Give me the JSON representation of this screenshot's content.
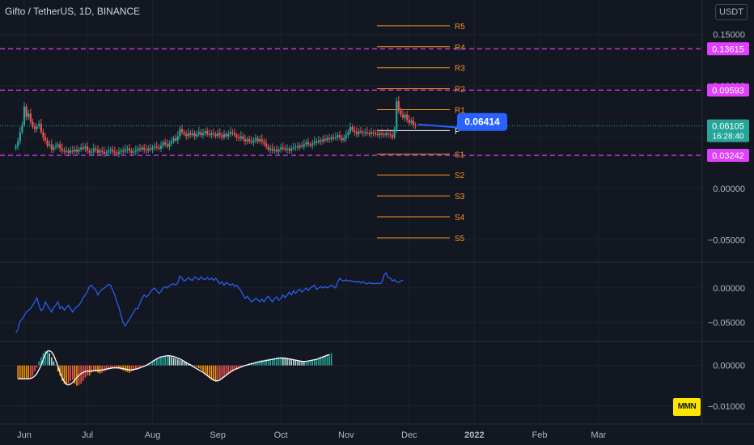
{
  "header": {
    "title": "Gifto / TetherUS, 1D, BINANCE",
    "currency": "USDT"
  },
  "logo": {
    "text": "MMN"
  },
  "colors": {
    "background": "#131722",
    "up": "#26a69a",
    "down": "#ef5350",
    "level_dash": "#e040fb",
    "pivot": "#f7931a",
    "indicator_line": "#2962ff",
    "callout": "#2962ff",
    "current_price": "#26a69a"
  },
  "chart_data": [
    {
      "type": "candlestick",
      "pane": "price",
      "x_ticks": [
        "Jun",
        "Jul",
        "Aug",
        "Sep",
        "Oct",
        "Nov",
        "Dec",
        "2022",
        "Feb",
        "Mar"
      ],
      "y_ticks": [
        "0.15000",
        "0.10000",
        "0.05000",
        "0.00000",
        "−0.05000"
      ],
      "ylim": [
        -0.07,
        0.16
      ],
      "y_tick_values": [
        0.15,
        0.1,
        0.05,
        0.0,
        -0.05
      ],
      "closes": [
        0.041,
        0.046,
        0.055,
        0.062,
        0.08,
        0.07,
        0.073,
        0.065,
        0.06,
        0.058,
        0.061,
        0.063,
        0.055,
        0.05,
        0.047,
        0.042,
        0.043,
        0.038,
        0.04,
        0.041,
        0.043,
        0.039,
        0.037,
        0.036,
        0.037,
        0.035,
        0.037,
        0.036,
        0.038,
        0.036,
        0.038,
        0.04,
        0.039,
        0.041,
        0.037,
        0.035,
        0.036,
        0.039,
        0.038,
        0.035,
        0.037,
        0.036,
        0.034,
        0.035,
        0.037,
        0.038,
        0.036,
        0.035,
        0.034,
        0.036,
        0.037,
        0.036,
        0.038,
        0.039,
        0.037,
        0.035,
        0.036,
        0.037,
        0.039,
        0.038,
        0.04,
        0.038,
        0.037,
        0.039,
        0.038,
        0.04,
        0.041,
        0.04,
        0.039,
        0.042,
        0.045,
        0.043,
        0.041,
        0.044,
        0.046,
        0.049,
        0.047,
        0.051,
        0.058,
        0.055,
        0.053,
        0.051,
        0.054,
        0.052,
        0.054,
        0.051,
        0.053,
        0.055,
        0.052,
        0.054,
        0.056,
        0.053,
        0.052,
        0.054,
        0.053,
        0.051,
        0.054,
        0.052,
        0.05,
        0.053,
        0.051,
        0.053,
        0.055,
        0.054,
        0.052,
        0.05,
        0.049,
        0.051,
        0.048,
        0.046,
        0.048,
        0.046,
        0.045,
        0.047,
        0.049,
        0.046,
        0.048,
        0.046,
        0.044,
        0.041,
        0.038,
        0.039,
        0.037,
        0.038,
        0.036,
        0.038,
        0.04,
        0.039,
        0.038,
        0.039,
        0.037,
        0.039,
        0.04,
        0.041,
        0.04,
        0.042,
        0.041,
        0.043,
        0.045,
        0.043,
        0.042,
        0.044,
        0.046,
        0.045,
        0.047,
        0.046,
        0.048,
        0.047,
        0.049,
        0.048,
        0.05,
        0.049,
        0.05,
        0.052,
        0.05,
        0.047,
        0.049,
        0.052,
        0.055,
        0.06,
        0.057,
        0.055,
        0.053,
        0.056,
        0.055,
        0.054,
        0.055,
        0.054,
        0.053,
        0.055,
        0.054,
        0.053,
        0.052,
        0.054,
        0.053,
        0.052,
        0.054,
        0.053,
        0.052,
        0.05,
        0.058,
        0.085,
        0.076,
        0.072,
        0.069,
        0.072,
        0.067,
        0.064,
        0.066,
        0.062,
        0.061
      ],
      "start_date": "2021-05-28",
      "current_price": 0.06105,
      "countdown": "16:28:40",
      "levels": [
        {
          "value": 0.13615,
          "label": "0.13615",
          "style": "dashed"
        },
        {
          "value": 0.09593,
          "label": "0.09593",
          "style": "dashed"
        },
        {
          "value": 0.03242,
          "label": "0.03242",
          "style": "dashed"
        }
      ],
      "pivots": [
        {
          "label": "R5",
          "value": 0.1585
        },
        {
          "label": "R4",
          "value": 0.1381
        },
        {
          "label": "R3",
          "value": 0.1177
        },
        {
          "label": "R2",
          "value": 0.0973
        },
        {
          "label": "R1",
          "value": 0.0769
        },
        {
          "label": "P",
          "value": 0.0565
        },
        {
          "label": "S1",
          "value": 0.0337
        },
        {
          "label": "S2",
          "value": 0.0133
        },
        {
          "label": "S3",
          "value": -0.0071
        },
        {
          "label": "S4",
          "value": -0.0275
        },
        {
          "label": "S5",
          "value": -0.0479
        }
      ],
      "callout": {
        "label": "0.06414",
        "value": 0.06414
      }
    },
    {
      "type": "line",
      "pane": "indicator-1",
      "y_ticks": [
        "0.00000",
        "−0.05000"
      ],
      "ylim": [
        -0.075,
        0.035
      ],
      "y_tick_values": [
        0.0,
        -0.05
      ],
      "values": [
        -0.065,
        -0.06,
        -0.048,
        -0.045,
        -0.04,
        -0.035,
        -0.032,
        -0.03,
        -0.025,
        -0.02,
        -0.014,
        -0.025,
        -0.033,
        -0.03,
        -0.02,
        -0.025,
        -0.03,
        -0.035,
        -0.028,
        -0.025,
        -0.02,
        -0.03,
        -0.027,
        -0.032,
        -0.028,
        -0.025,
        -0.03,
        -0.035,
        -0.03,
        -0.027,
        -0.025,
        -0.02,
        -0.014,
        -0.01,
        -0.005,
        0.002,
        0.004,
        0.0,
        -0.003,
        -0.01,
        -0.005,
        -0.002,
        0.0,
        0.002,
        0.005,
        0.004,
        -0.003,
        -0.01,
        -0.02,
        -0.028,
        -0.04,
        -0.05,
        -0.055,
        -0.05,
        -0.045,
        -0.04,
        -0.035,
        -0.03,
        -0.03,
        -0.022,
        -0.015,
        -0.01,
        -0.013,
        -0.01,
        -0.006,
        -0.002,
        0.0,
        -0.004,
        -0.008,
        -0.005,
        0.0,
        0.002,
        0.0,
        0.003,
        0.005,
        0.006,
        0.004,
        0.008,
        0.017,
        0.014,
        0.01,
        0.012,
        0.015,
        0.012,
        0.011,
        0.016,
        0.014,
        0.012,
        0.016,
        0.013,
        0.012,
        0.015,
        0.012,
        0.014,
        0.011,
        0.014,
        0.01,
        0.006,
        0.009,
        0.004,
        0.008,
        0.006,
        0.004,
        0.006,
        0.002,
        0.004,
        0.0,
        -0.004,
        -0.01,
        -0.015,
        -0.012,
        -0.016,
        -0.02,
        -0.018,
        -0.015,
        -0.017,
        -0.02,
        -0.016,
        -0.02,
        -0.015,
        -0.012,
        -0.016,
        -0.02,
        -0.015,
        -0.013,
        -0.018,
        -0.015,
        -0.01,
        -0.014,
        -0.01,
        -0.006,
        -0.01,
        -0.004,
        -0.008,
        -0.004,
        -0.002,
        -0.006,
        -0.003,
        0.0,
        -0.004,
        0.0,
        0.002,
        0.004,
        -0.002,
        0.0,
        0.002,
        0.0,
        0.002,
        0.0,
        0.002,
        0.004,
        0.002,
        0.0,
        0.009,
        0.014,
        0.011,
        0.01,
        0.012,
        0.01,
        0.011,
        0.009,
        0.01,
        0.008,
        0.01,
        0.007,
        0.009,
        0.007,
        0.006,
        0.008,
        0.006,
        0.007,
        0.006,
        0.007,
        0.006,
        0.008,
        0.018,
        0.022,
        0.015,
        0.014,
        0.01,
        0.012,
        0.009,
        0.008,
        0.01,
        0.011
      ]
    },
    {
      "type": "histogram",
      "pane": "indicator-2",
      "y_ticks": [
        "0.00000",
        "−0.01000"
      ],
      "ylim": [
        -0.014,
        0.0055
      ],
      "y_tick_values": [
        0.0,
        -0.01
      ],
      "values": [
        -0.0033,
        -0.0033,
        -0.0033,
        -0.0033,
        -0.0033,
        -0.0033,
        -0.003,
        -0.0025,
        -0.0015,
        -0.0005,
        0.001,
        0.002,
        0.003,
        0.0035,
        0.0035,
        0.003,
        0.002,
        0.001,
        0.0,
        -0.0015,
        -0.0025,
        -0.0038,
        -0.0045,
        -0.0048,
        -0.0045,
        -0.0038,
        -0.0035,
        -0.0045,
        -0.005,
        -0.0048,
        -0.0045,
        -0.0038,
        -0.003,
        -0.0025,
        -0.0025,
        -0.0018,
        -0.0015,
        -0.0015,
        -0.0018,
        -0.002,
        -0.0018,
        -0.0015,
        -0.0012,
        -0.001,
        -0.0008,
        -0.0006,
        -0.0005,
        -0.0006,
        -0.0008,
        -0.001,
        -0.0012,
        -0.0015,
        -0.0016,
        -0.0018,
        -0.0015,
        -0.0013,
        -0.001,
        -0.0008,
        -0.0006,
        -0.0004,
        -0.0002,
        0.0,
        0.0003,
        0.0006,
        0.001,
        0.0013,
        0.0016,
        0.0018,
        0.002,
        0.002,
        0.0022,
        0.0024,
        0.0023,
        0.0021,
        0.0019,
        0.0017,
        0.0015,
        0.0013,
        0.0011,
        0.0009,
        0.0007,
        0.0005,
        0.0003,
        0.0001,
        -0.0002,
        -0.0004,
        -0.0007,
        -0.001,
        -0.0015,
        -0.002,
        -0.0025,
        -0.003,
        -0.0035,
        -0.0038,
        -0.004,
        -0.0038,
        -0.0035,
        -0.003,
        -0.0025,
        -0.0022,
        -0.002,
        -0.0017,
        -0.0015,
        -0.0012,
        -0.001,
        -0.0008,
        -0.0005,
        -0.0003,
        0.0,
        0.0002,
        0.0004,
        0.0006,
        0.0007,
        0.0008,
        0.001,
        0.0012,
        0.0013,
        0.0014,
        0.0015,
        0.0016,
        0.0016,
        0.0017,
        0.0018,
        0.0019,
        0.002,
        0.0021,
        0.002,
        0.0019,
        0.0018,
        0.0017,
        0.0016,
        0.0015,
        0.0014,
        0.0013,
        0.0012,
        0.0011,
        0.001,
        0.001,
        0.0011,
        0.0012,
        0.0013,
        0.0014,
        0.0016,
        0.0018,
        0.002,
        0.0022,
        0.0024,
        0.0026,
        0.0028,
        0.003
      ],
      "signal": [
        -0.0033,
        -0.0033,
        -0.0033,
        -0.0033,
        -0.0033,
        -0.0033,
        -0.0032,
        -0.003,
        -0.0026,
        -0.002,
        -0.001,
        0.0,
        0.0015,
        0.0028,
        0.0035,
        0.0036,
        0.0033,
        0.0025,
        0.0012,
        -0.0002,
        -0.0018,
        -0.003,
        -0.004,
        -0.0046,
        -0.0048,
        -0.0046,
        -0.0042,
        -0.0036,
        -0.003,
        -0.0024,
        -0.002,
        -0.0017,
        -0.0015,
        -0.0014,
        -0.0014,
        -0.0014,
        -0.0013,
        -0.0012,
        -0.0012,
        -0.0012,
        -0.0011,
        -0.001,
        -0.0009,
        -0.0008,
        -0.0007,
        -0.0006,
        -0.0006,
        -0.0006,
        -0.0006,
        -0.0007,
        -0.0008,
        -0.0009,
        -0.001,
        -0.0011,
        -0.0011,
        -0.001,
        -0.0009,
        -0.0008,
        -0.0006,
        -0.0004,
        -0.0002,
        0.0,
        0.0003,
        0.0006,
        0.001,
        0.0013,
        0.0016,
        0.0019,
        0.0021,
        0.0022,
        0.0023,
        0.0024,
        0.0024,
        0.0023,
        0.0022,
        0.002,
        0.0018,
        0.0016,
        0.0013,
        0.001,
        0.0007,
        0.0004,
        0.0001,
        -0.0002,
        -0.0005,
        -0.0008,
        -0.0011,
        -0.0014,
        -0.0017,
        -0.0021,
        -0.0025,
        -0.0029,
        -0.0033,
        -0.0036,
        -0.0038,
        -0.0038,
        -0.0036,
        -0.0032,
        -0.0028,
        -0.0024,
        -0.002,
        -0.0016,
        -0.0013,
        -0.001,
        -0.0008,
        -0.0006,
        -0.0004,
        -0.0002,
        0.0,
        0.0001,
        0.0003,
        0.0004,
        0.0005,
        0.0007,
        0.0008,
        0.0009,
        0.001,
        0.0011,
        0.0012,
        0.0013,
        0.0014,
        0.0015,
        0.0016,
        0.0017,
        0.0018,
        0.0018,
        0.0018,
        0.0018,
        0.0017,
        0.0016,
        0.0015,
        0.0014,
        0.0013,
        0.0012,
        0.0011,
        0.001,
        0.001,
        0.001,
        0.0011,
        0.0012,
        0.0013,
        0.0014,
        0.0015,
        0.0017,
        0.0019,
        0.0021,
        0.0023,
        0.0025,
        0.0027
      ]
    }
  ]
}
